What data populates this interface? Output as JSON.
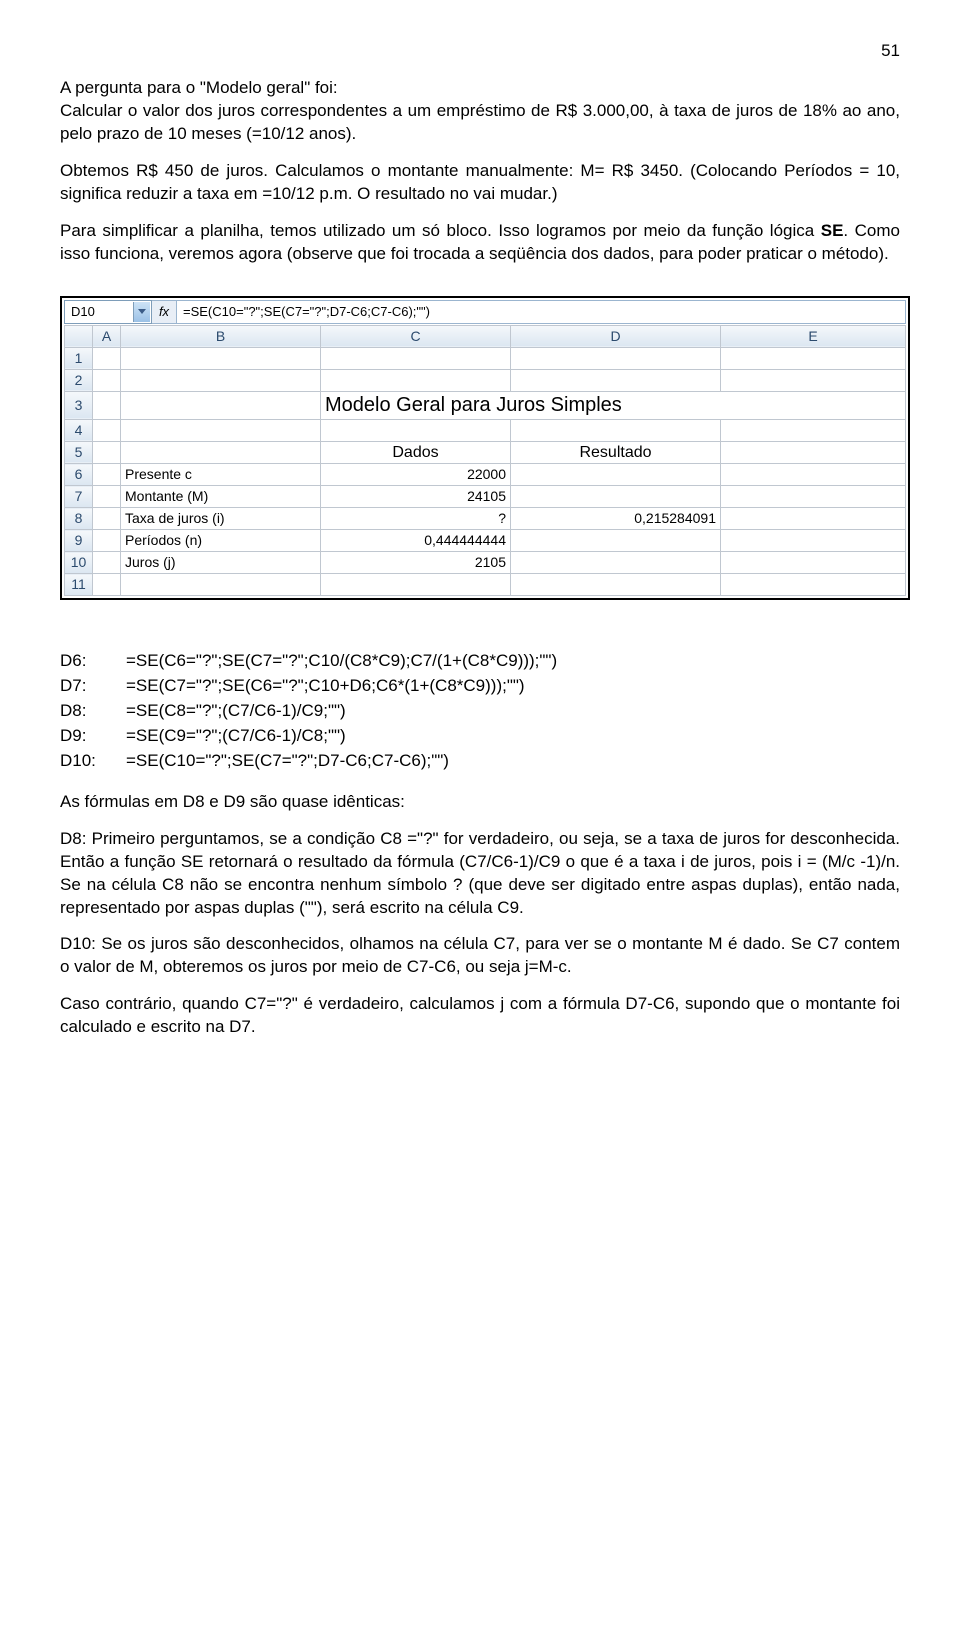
{
  "page_number": "51",
  "para1_a": "A pergunta para o \"Modelo geral\" foi:",
  "para1_b": "Calcular o valor dos juros correspondentes a um empréstimo de R$ 3.000,00, à taxa de juros de 18% ao ano, pelo prazo de 10 meses (=10/12 anos).",
  "para2": "Obtemos R$ 450 de juros. Calculamos o montante manualmente: M= R$ 3450. (Colocando Períodos = 10, significa reduzir a taxa em =10/12 p.m. O resultado no vai mudar.)",
  "para3_a": "Para simplificar a planilha, temos utilizado um só bloco.  Isso logramos por meio da função lógica ",
  "para3_b": "SE",
  "para3_c": ". Como isso funciona, veremos agora (observe que foi trocada a seqüência dos dados, para poder praticar o método).",
  "spreadsheet": {
    "cellref": "D10",
    "fx": "fx",
    "formula": "=SE(C10=\"?\";SE(C7=\"?\";D7-C6;C7-C6);\"\")",
    "cols": [
      "",
      "A",
      "B",
      "C",
      "D",
      "E"
    ],
    "rows": [
      {
        "n": "1",
        "B": "",
        "C": "",
        "D": "",
        "E": ""
      },
      {
        "n": "2",
        "B": "",
        "C": "",
        "D": "",
        "E": ""
      },
      {
        "n": "3",
        "B": "",
        "C": "Modelo Geral para Juros Simples",
        "D": "",
        "E": "",
        "title": true
      },
      {
        "n": "4",
        "B": "",
        "C": "",
        "D": "",
        "E": ""
      },
      {
        "n": "5",
        "B": "",
        "C": "Dados",
        "D": "Resultado",
        "E": "",
        "section": true
      },
      {
        "n": "6",
        "B": "Presente c",
        "C": "22000",
        "D": "",
        "E": ""
      },
      {
        "n": "7",
        "B": "Montante (M)",
        "C": "24105",
        "D": "",
        "E": ""
      },
      {
        "n": "8",
        "B": "Taxa de juros (i)",
        "C": "?",
        "D": "0,215284091",
        "E": ""
      },
      {
        "n": "9",
        "B": "Períodos (n)",
        "C": "0,444444444",
        "D": "",
        "E": ""
      },
      {
        "n": "10",
        "B": "Juros (j)",
        "C": "2105",
        "D": "",
        "E": ""
      },
      {
        "n": "11",
        "B": "",
        "C": "",
        "D": "",
        "E": ""
      }
    ]
  },
  "formulas": [
    {
      "k": "D6:",
      "v": "=SE(C6=\"?\";SE(C7=\"?\";C10/(C8*C9);C7/(1+(C8*C9)));\"\")"
    },
    {
      "k": "D7:",
      "v": "=SE(C7=\"?\";SE(C6=\"?\";C10+D6;C6*(1+(C8*C9)));\"\")"
    },
    {
      "k": "D8:",
      "v": "=SE(C8=\"?\";(C7/C6-1)/C9;\"\")"
    },
    {
      "k": "D9:",
      "v": "=SE(C9=\"?\";(C7/C6-1)/C8;\"\")"
    },
    {
      "k": "D10:",
      "v": "=SE(C10=\"?\";SE(C7=\"?\";D7-C6;C7-C6);\"\")"
    }
  ],
  "para4": "As fórmulas em D8 e D9 são quase idênticas:",
  "para5": "D8: Primeiro perguntamos, se a condição C8 =\"?\" for verdadeiro, ou seja, se a taxa de juros for desconhecida. Então a função SE retornará o resultado da fórmula (C7/C6-1)/C9 o que é a taxa i de juros, pois i = (M/c -1)/n. Se na célula C8 não se encontra nenhum símbolo ? (que deve ser digitado entre aspas duplas), então nada, representado por aspas duplas (\"\"), será escrito na célula C9.",
  "para6": "D10: Se os juros são desconhecidos, olhamos na célula C7, para ver se o montante M é dado. Se C7 contem o valor de M, obteremos os juros por meio de C7-C6, ou seja j=M-c.",
  "para7": "Caso contrário, quando C7=\"?\" é verdadeiro, calculamos j com a fórmula D7-C6, supondo que  o montante foi calculado e escrito na D7."
}
